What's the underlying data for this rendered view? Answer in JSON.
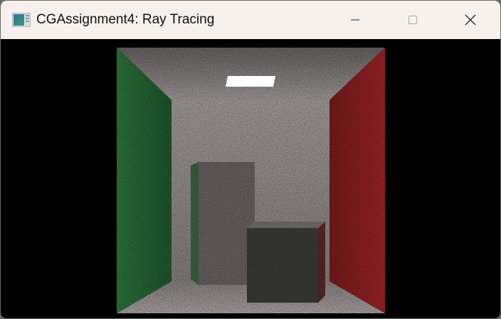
{
  "window": {
    "title": "CGAssignment4: Ray Tracing",
    "icon": "app-window-icon",
    "controls": [
      "minimize-icon",
      "maximize-icon",
      "close-icon"
    ]
  },
  "scene": {
    "description_colors": {
      "left_wall": "#2f7a3c",
      "right_wall": "#a32424",
      "white": "#b7b0ae",
      "light": "#ffffff"
    }
  }
}
